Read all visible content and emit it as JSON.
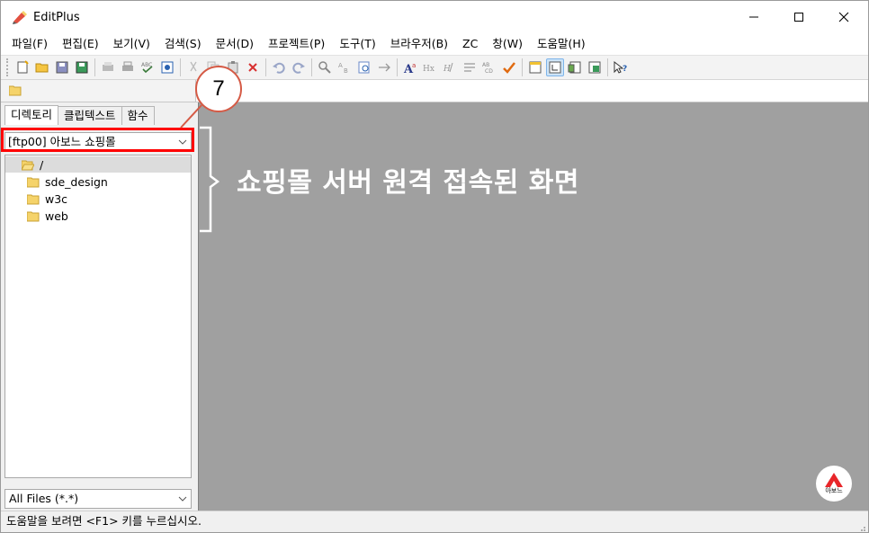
{
  "app": {
    "title": "EditPlus"
  },
  "menu": [
    "파일(F)",
    "편집(E)",
    "보기(V)",
    "검색(S)",
    "문서(D)",
    "프로젝트(P)",
    "도구(T)",
    "브라우저(B)",
    "ZC",
    "창(W)",
    "도움말(H)"
  ],
  "toolbar": {
    "icons": [
      "new-file-icon",
      "open-file-icon",
      "save-icon",
      "save-all-icon",
      "print-preview-icon",
      "print-icon",
      "spellcheck-icon",
      "browser-preview-icon",
      "cut-icon",
      "copy-icon",
      "paste-icon",
      "delete-icon",
      "undo-icon",
      "redo-icon",
      "find-icon",
      "replace-icon",
      "find-in-files-icon",
      "go-to-line-icon",
      "font-icon",
      "heading-icon",
      "html-toolbar-icon",
      "word-wrap-icon",
      "line-number-icon",
      "check-icon",
      "window-icon",
      "word-wrap-toggle-icon",
      "directory-window-icon",
      "output-window-icon",
      "context-help-icon"
    ],
    "active_icon": "word-wrap-toggle-icon"
  },
  "sidebar": {
    "tabs": [
      "디렉토리",
      "클립텍스트",
      "함수"
    ],
    "active_tab": "디렉토리",
    "location": "[ftp00] 아보느 쇼핑몰",
    "tree": [
      {
        "label": "/",
        "selected": true
      },
      {
        "label": "sde_design",
        "selected": false
      },
      {
        "label": "w3c",
        "selected": false
      },
      {
        "label": "web",
        "selected": false
      }
    ],
    "filter": "All Files (*.*)"
  },
  "status": {
    "text": "도움말을 보려면 <F1> 키를 누르십시오."
  },
  "annotation": {
    "step_number": "7",
    "caption": "쇼핑몰 서버 원격 접속된 화면",
    "highlight_color": "#ff0000",
    "callout_color": "#d55a45"
  },
  "logo": {
    "text": "아보느",
    "brand_color": "#e8262a"
  },
  "colors": {
    "editor_bg": "#a0a0a0",
    "titlebar_bg": "#ffffff",
    "toolbar_bg": "#f3f3f3"
  }
}
